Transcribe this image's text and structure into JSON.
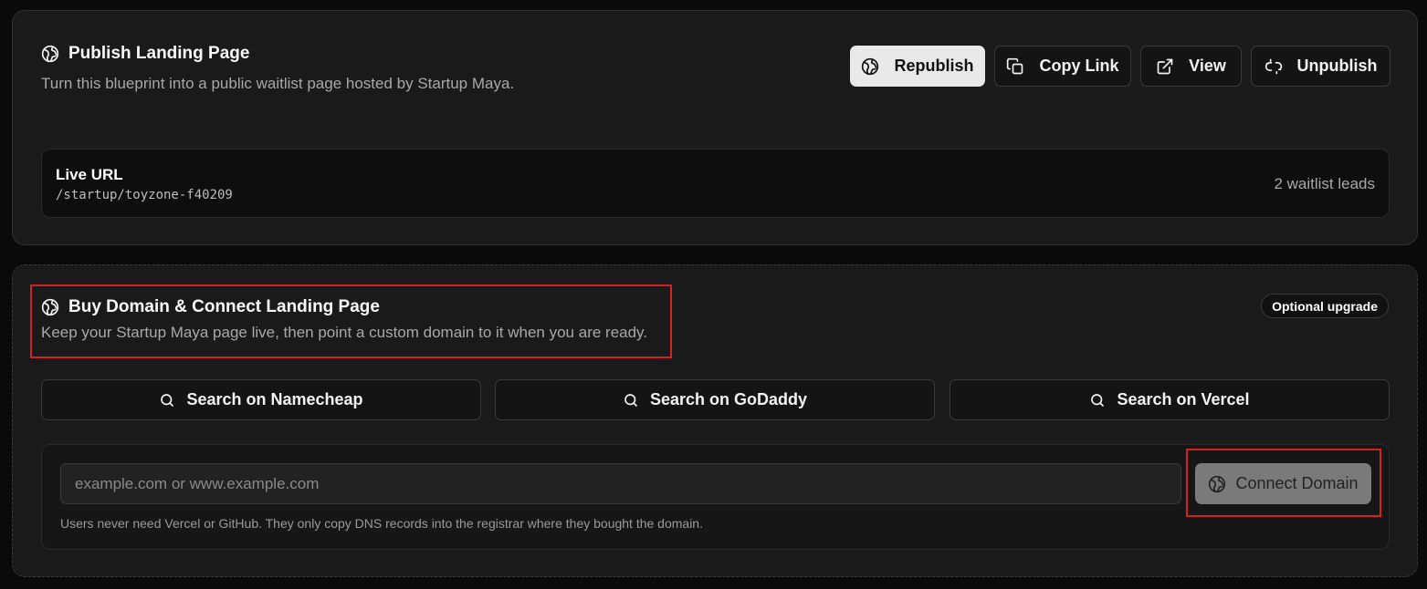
{
  "publish": {
    "title": "Publish Landing Page",
    "subtitle": "Turn this blueprint into a public waitlist page hosted by Startup Maya.",
    "buttons": {
      "republish": "Republish",
      "copy_link": "Copy Link",
      "view": "View",
      "unpublish": "Unpublish"
    },
    "live": {
      "label": "Live URL",
      "url": "/startup/toyzone-f40209",
      "leads": "2 waitlist leads"
    }
  },
  "domain": {
    "title": "Buy Domain & Connect Landing Page",
    "subtitle": "Keep your Startup Maya page live, then point a custom domain to it when you are ready.",
    "badge": "Optional upgrade",
    "search": [
      {
        "label": "Search on Namecheap"
      },
      {
        "label": "Search on GoDaddy"
      },
      {
        "label": "Search on Vercel"
      }
    ],
    "input_value": "",
    "input_placeholder": "example.com or www.example.com",
    "connect_label": "Connect Domain",
    "helper": "Users never need Vercel or GitHub. They only copy DNS records into the registrar where they bought the domain."
  },
  "colors": {
    "background": "#0a0a0a",
    "card": "#1a1a1a",
    "primary_button": "#e9e9e9",
    "connect_button": "#7a7a7a",
    "highlight": "#d32222"
  }
}
